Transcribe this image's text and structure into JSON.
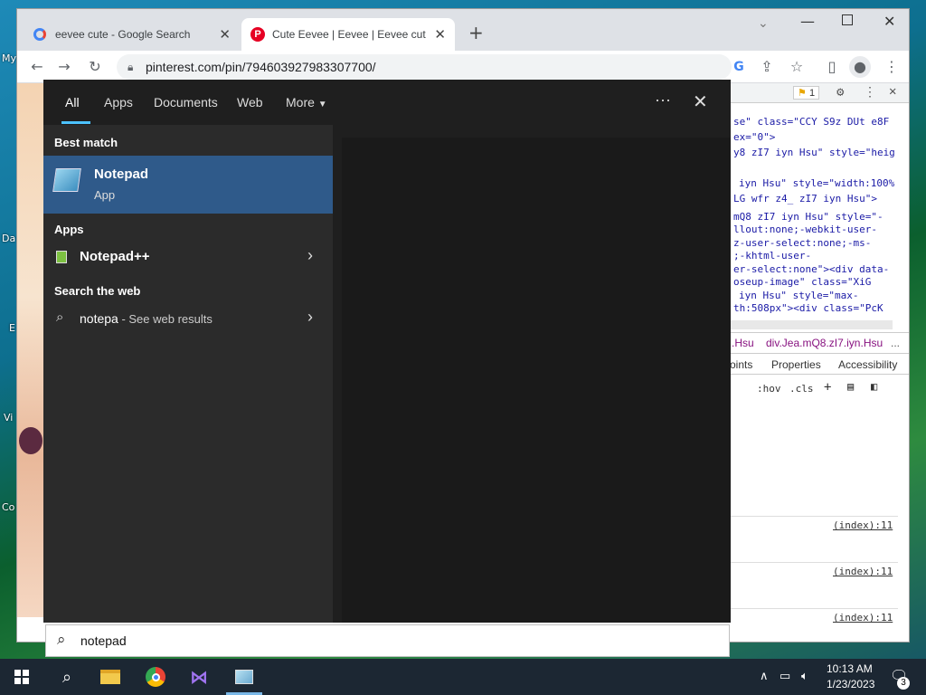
{
  "desktop": {
    "icons": [
      "My",
      "Da",
      "E",
      "Vi",
      "Co"
    ]
  },
  "browser": {
    "tabs": [
      {
        "title": "eevee cute - Google Search",
        "icon": "google-icon"
      },
      {
        "title": "Cute Eevee | Eevee | Eevee cute, ",
        "icon": "pinterest-icon"
      }
    ],
    "url": "pinterest.com/pin/794603927983307700/"
  },
  "devtools": {
    "issues_count": "1",
    "code_lines": [
      "se\" class=\"CCY S9z DUt e8F",
      "ex=\"0\">",
      "y8 zI7 iyn Hsu\" style=\"heig",
      "iyn Hsu\" style=\"width:100%",
      "LG wfr z4_ zI7 iyn Hsu\">",
      "mQ8 zI7 iyn Hsu\" style=\"-",
      "llout:none;-webkit-user-",
      "z-user-select:none;-ms-",
      ";-khtml-user-",
      "er-select:none\"><div data-",
      "oseup-image\" class=\"XiG",
      "iyn Hsu\" style=\"max-",
      "th:508px\"><div class=\"PcK",
      "eCV zI7 iyn Hsu\""
    ],
    "breadcrumb": [
      ".Hsu",
      "div.Jea.mQ8.zI7.iyn.Hsu",
      "..."
    ],
    "panel_tabs": [
      "oints",
      "Properties",
      "Accessibility"
    ],
    "filter_hov": ":hov",
    "filter_cls": ".cls",
    "index_refs": [
      "(index):11",
      "(index):11",
      "(index):11"
    ]
  },
  "start_menu": {
    "tabs": [
      "All",
      "Apps",
      "Documents",
      "Web",
      "More"
    ],
    "more_icon": "ellipsis-icon",
    "best_match_header": "Best match",
    "best_match": {
      "name": "Notepad",
      "type": "App"
    },
    "apps_header": "Apps",
    "apps": [
      {
        "name": "Notepad++"
      }
    ],
    "web_header": "Search the web",
    "web_query": "notepa",
    "web_suffix": " - See web results",
    "search_text": "notepad"
  },
  "taskbar": {
    "time": "10:13 AM",
    "date": "1/23/2023",
    "notifications": "3"
  }
}
